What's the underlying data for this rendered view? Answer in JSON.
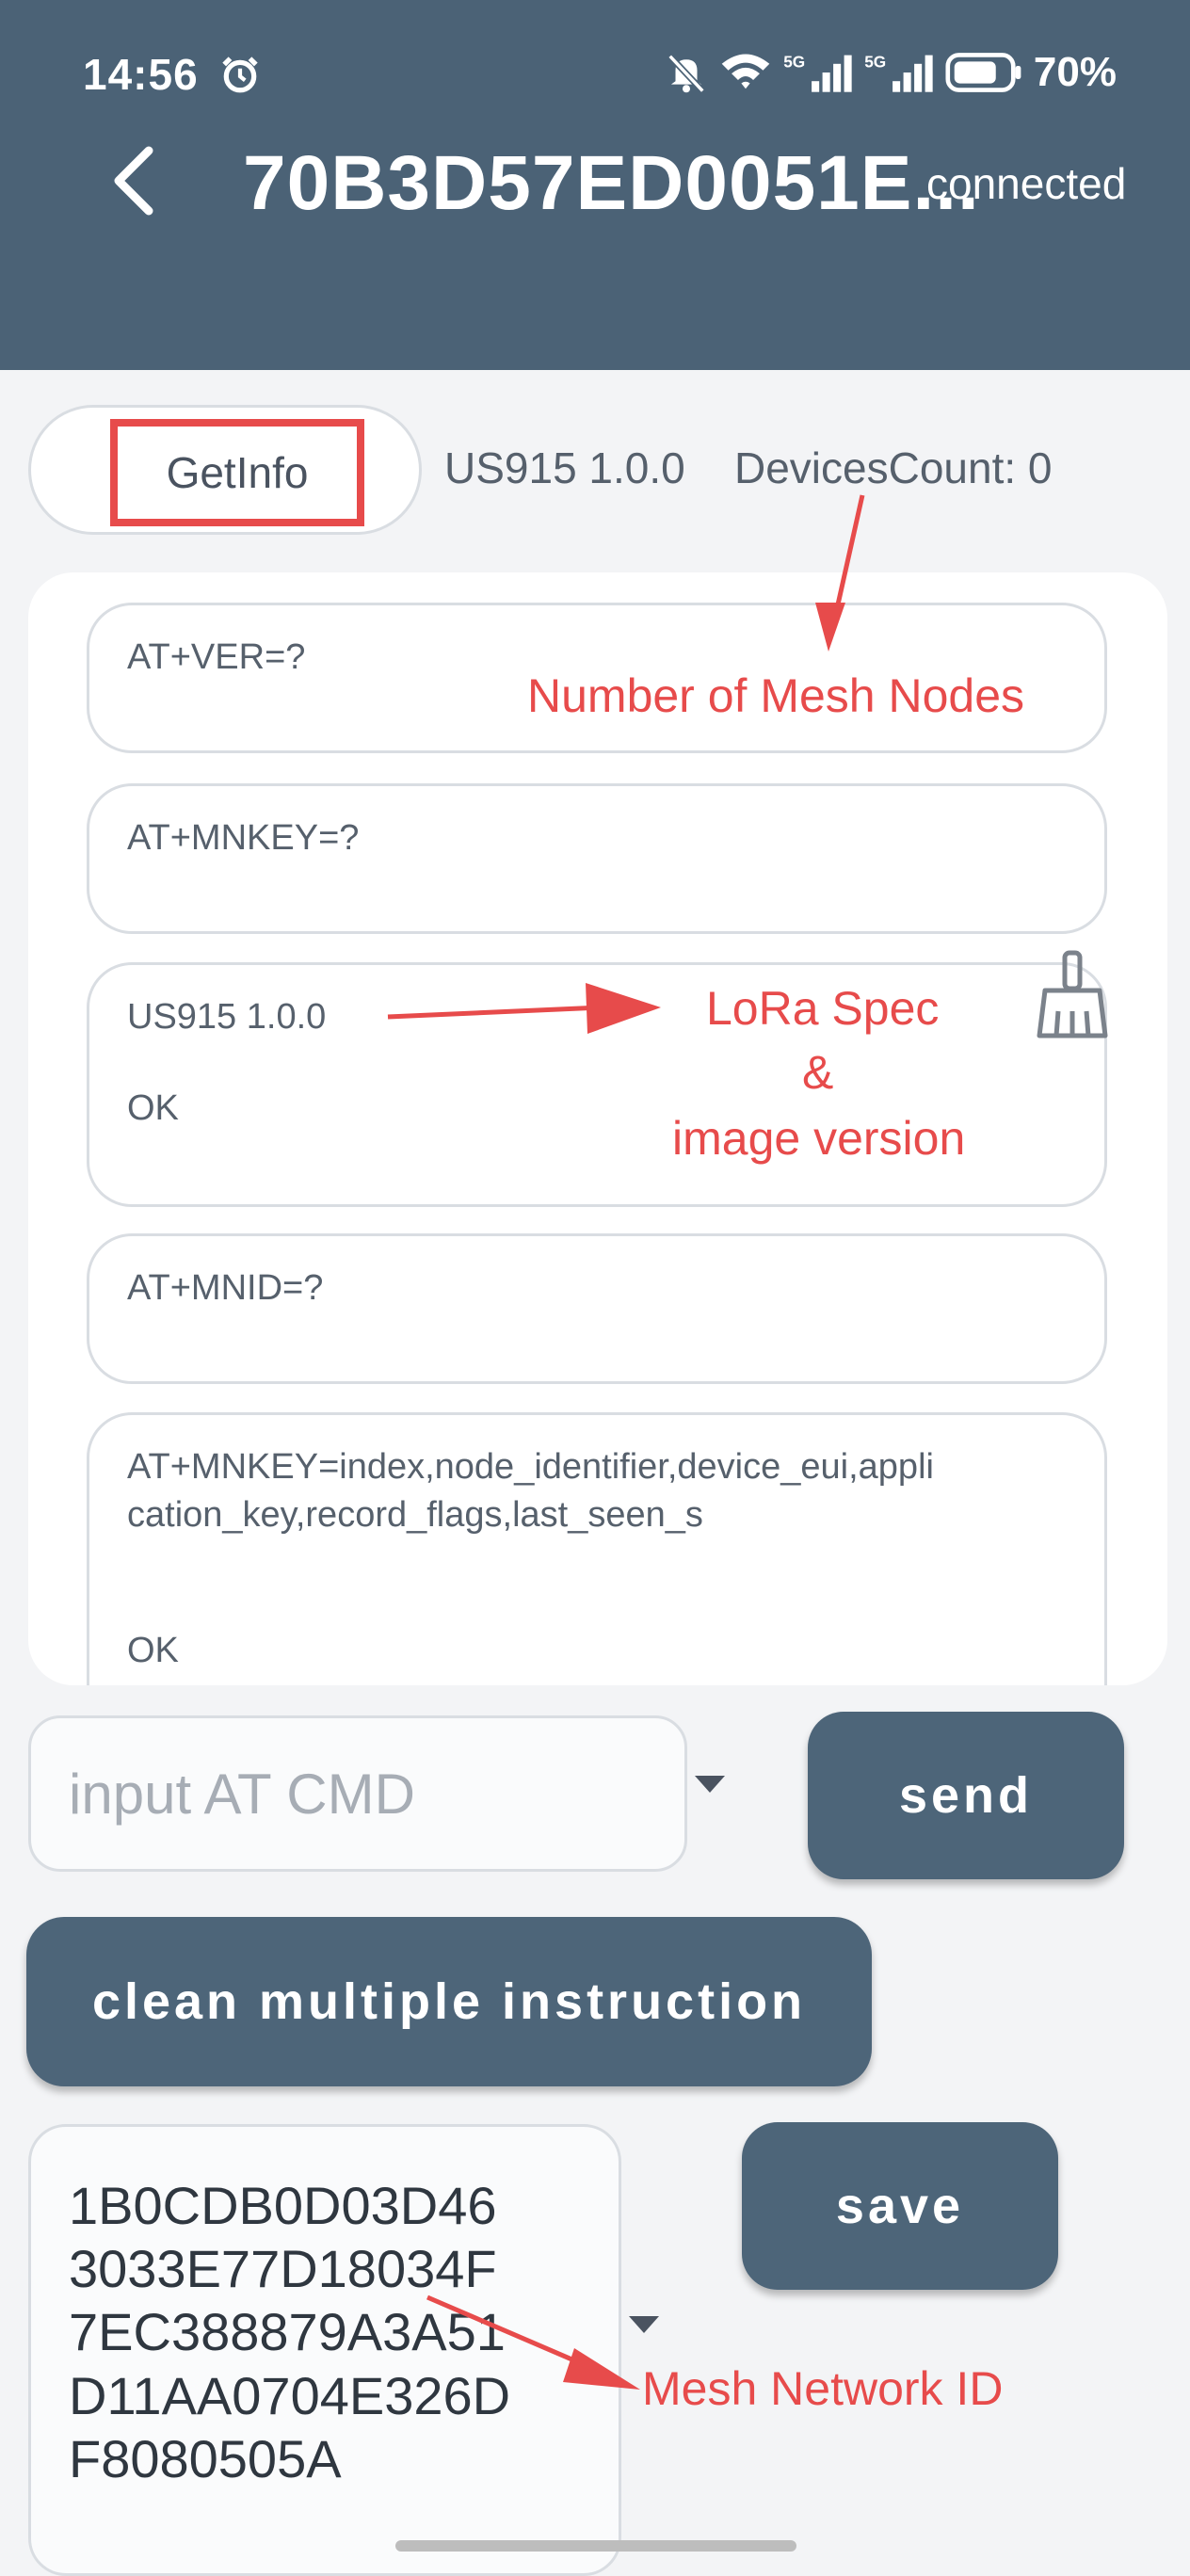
{
  "status_bar": {
    "time": "14:56",
    "battery": "70%"
  },
  "header": {
    "title": "70B3D57ED0051E...",
    "connection_status": "connected"
  },
  "toolbar": {
    "getinfo_label": "GetInfo",
    "version_info": "US915 1.0.0",
    "devices_count": "DevicesCount: 0"
  },
  "log": {
    "cards": [
      {
        "lines": [
          "AT+VER=?"
        ]
      },
      {
        "lines": [
          "AT+MNKEY=?"
        ]
      },
      {
        "lines": [
          "US915 1.0.0",
          "OK"
        ]
      },
      {
        "lines": [
          "AT+MNID=?"
        ]
      },
      {
        "lines": [
          "AT+MNKEY=index,node_identifier,device_eui,appli",
          "cation_key,record_flags,last_seen_s",
          "OK"
        ]
      }
    ]
  },
  "command": {
    "input_placeholder": "input AT CMD",
    "input_value": "",
    "send_label": "send"
  },
  "clean_label": "clean multiple instruction",
  "mesh_key": {
    "lines": [
      "1B0CDB0D03D46",
      "3033E77D18034F",
      "7EC388879A3A51",
      "D11AA0704E326D",
      "F8080505A"
    ],
    "save_label": "save"
  },
  "annotations": {
    "mesh_nodes": "Number of Mesh Nodes",
    "lora_spec": [
      "LoRa Spec",
      "&",
      "image version"
    ],
    "mesh_network_id": "Mesh Network ID"
  },
  "colors": {
    "header": "#4b6276",
    "button": "#4d6579",
    "annotation": "#e74b4b",
    "background": "#f3f4f6"
  },
  "icons": [
    "alarm-icon",
    "mute-icon",
    "wifi-icon",
    "signal-icon",
    "battery-icon",
    "back-arrow-icon",
    "broom-icon",
    "chevron-down-icon"
  ]
}
